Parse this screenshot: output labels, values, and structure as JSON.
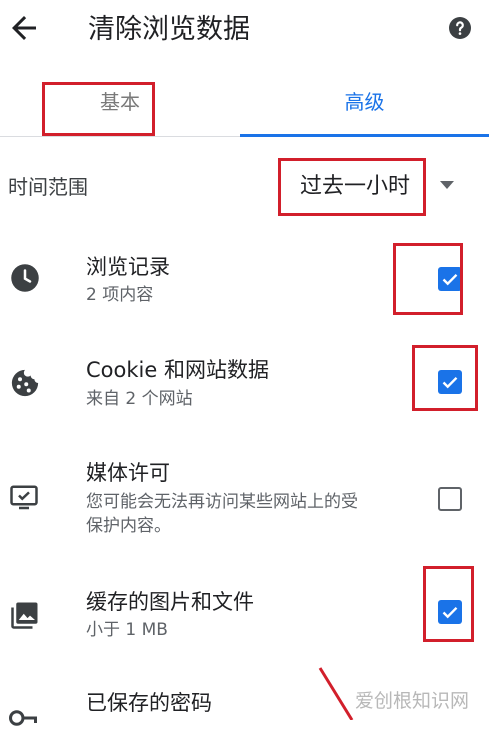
{
  "header": {
    "title": "清除浏览数据",
    "back_icon": "arrow-left-icon",
    "help_icon": "help-circle-icon"
  },
  "tabs": [
    {
      "label": "基本",
      "selected": false
    },
    {
      "label": "高级",
      "selected": true
    }
  ],
  "time_range": {
    "label": "时间范围",
    "value": "过去一小时"
  },
  "items": [
    {
      "icon": "clock-icon",
      "title": "浏览记录",
      "subtitle": "2 项内容",
      "checked": true
    },
    {
      "icon": "cookie-icon",
      "title": "Cookie 和网站数据",
      "subtitle": "来自 2 个网站",
      "checked": true
    },
    {
      "icon": "monitor-icon",
      "title": "媒体许可",
      "subtitle_lines": [
        "您可能会无法再访问某些网站上的受",
        "保护内容。"
      ],
      "checked": false
    },
    {
      "icon": "image-icon",
      "title": "缓存的图片和文件",
      "subtitle": "小于 1 MB",
      "checked": true
    },
    {
      "icon": "key-icon",
      "title": "已保存的密码"
    }
  ],
  "watermark": "爱创根知识网",
  "colors": {
    "accent": "#1a73e8",
    "annotation_red": "#d21f2b",
    "text": "#202124",
    "secondary": "#5f6368"
  }
}
